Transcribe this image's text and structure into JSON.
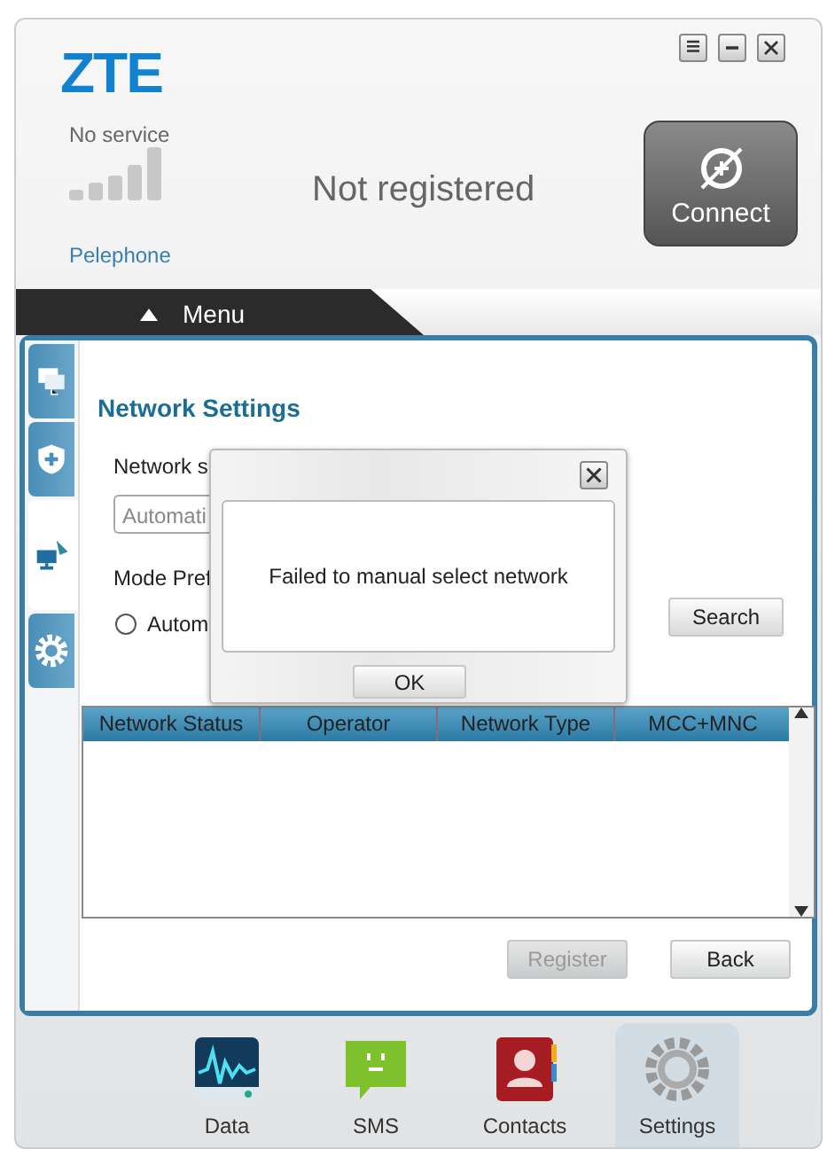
{
  "window": {
    "logo": "ZTE"
  },
  "status": {
    "service": "No service",
    "operator": "Pelephone",
    "registration": "Not registered",
    "connect_button": "Connect"
  },
  "menu": {
    "label": "Menu"
  },
  "side_tabs": [
    {
      "selected": false
    },
    {
      "selected": false
    },
    {
      "selected": true
    },
    {
      "selected": false
    }
  ],
  "network_settings": {
    "title": "Network Settings",
    "selection_label": "Network s",
    "selection_value": "Automati",
    "mode_label": "Mode Pref",
    "mode_option": {
      "label": "Autom",
      "selected": false
    },
    "search_button": "Search",
    "table": {
      "columns": [
        "Network Status",
        "Operator",
        "Network Type",
        "MCC+MNC"
      ]
    },
    "buttons": [
      {
        "label": "Register",
        "disabled": true
      },
      {
        "label": "Back",
        "disabled": false
      }
    ]
  },
  "dialog": {
    "message": "Failed to manual select network",
    "ok_button": "OK"
  },
  "bottom_nav": [
    {
      "label": "Data",
      "selected": false
    },
    {
      "label": "SMS",
      "selected": false
    },
    {
      "label": "Contacts",
      "selected": false
    },
    {
      "label": "Settings",
      "selected": true
    }
  ]
}
